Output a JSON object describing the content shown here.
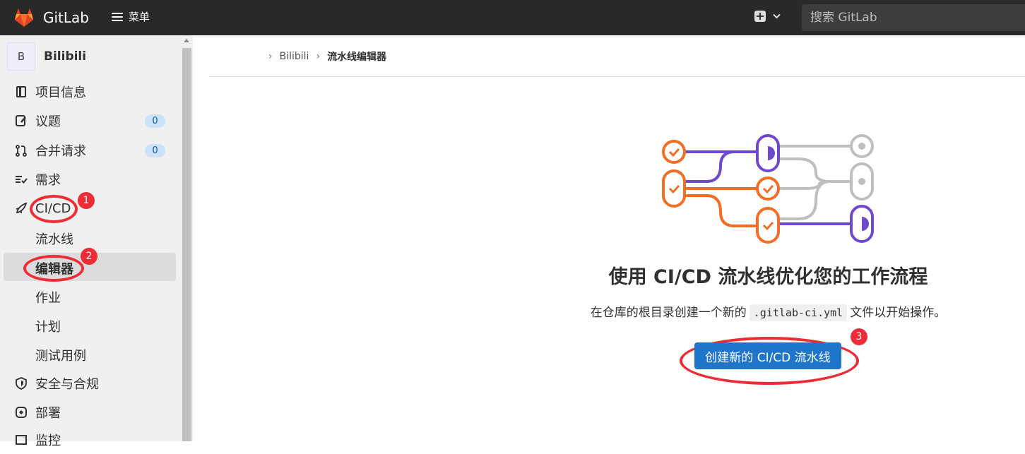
{
  "navbar": {
    "brand": "GitLab",
    "menu_label": "菜单",
    "new_icon": "plus-square-icon",
    "dropdown_icon": "chevron-down-icon",
    "search_placeholder": "搜索 GitLab"
  },
  "sidebar": {
    "project_initial": "B",
    "project_name": "Bilibili",
    "items": [
      {
        "label": "项目信息",
        "icon": "project-icon"
      },
      {
        "label": "议题",
        "icon": "issues-icon",
        "badge": "0"
      },
      {
        "label": "合并请求",
        "icon": "merge-request-icon",
        "badge": "0"
      },
      {
        "label": "需求",
        "icon": "requirements-icon"
      },
      {
        "label": "CI/CD",
        "icon": "rocket-icon"
      },
      {
        "label": "安全与合规",
        "icon": "shield-icon"
      },
      {
        "label": "部署",
        "icon": "deployments-icon"
      },
      {
        "label": "监控",
        "icon": "monitor-icon"
      }
    ],
    "cicd_sub": [
      "流水线",
      "编辑器",
      "作业",
      "计划",
      "测试用例"
    ]
  },
  "breadcrumb": {
    "project": "Bilibili",
    "current": "流水线编辑器"
  },
  "main": {
    "headline": "使用 CI/CD 流水线优化您的工作流程",
    "desc_before": "在仓库的根目录创建一个新的",
    "desc_code": ".gitlab-ci.yml",
    "desc_after": "文件以开始操作。",
    "cta_label": "创建新的 CI/CD 流水线"
  },
  "annotations": [
    "1",
    "2",
    "3"
  ],
  "colors": {
    "navbar_bg": "#292929",
    "accent": "#1f75cb",
    "annotation_red": "#ee2c36",
    "illus_orange": "#f26e24",
    "illus_purple": "#6e49cb",
    "illus_gray": "#bfbfbf"
  }
}
